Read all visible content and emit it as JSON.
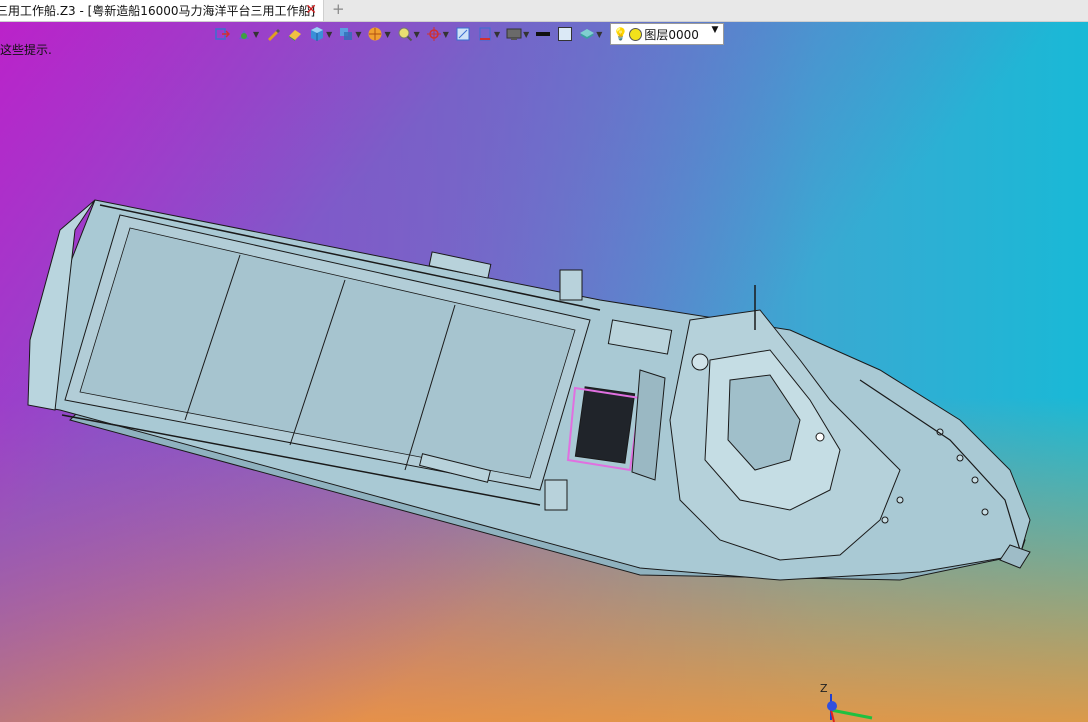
{
  "tab": {
    "title": "三用工作船.Z3 - [粤新造船16000马力海洋平台三用工作船]",
    "close_glyph": "✕",
    "add_glyph": "+"
  },
  "hint_text": "这些提示.",
  "toolbar": {
    "tools": [
      {
        "icon": "exit-sketch-icon",
        "dropdown": false
      },
      {
        "icon": "sketch-tools-icon",
        "dropdown": true
      },
      {
        "icon": "pen-icon",
        "dropdown": false
      },
      {
        "icon": "eraser-icon",
        "dropdown": false
      },
      {
        "icon": "cube-icon",
        "dropdown": true
      },
      {
        "icon": "views-icon",
        "dropdown": true
      },
      {
        "icon": "render-sphere-icon",
        "dropdown": true
      },
      {
        "icon": "zoom-icon",
        "dropdown": true
      },
      {
        "icon": "pivot-icon",
        "dropdown": true
      },
      {
        "icon": "fit-view-icon",
        "dropdown": false
      },
      {
        "icon": "section-icon",
        "dropdown": true
      },
      {
        "icon": "monitor-icon",
        "dropdown": true
      },
      {
        "icon": "line-weight-icon",
        "dropdown": false
      },
      {
        "icon": "color-swatch-icon",
        "dropdown": false
      },
      {
        "icon": "layers-icon",
        "dropdown": true
      }
    ],
    "layer": {
      "name": "图层0000",
      "color": "#f2e21a"
    }
  },
  "colors": {
    "hull": "#a9c9d4",
    "edge": "#1a1a1a",
    "highlight": "#e070e0"
  },
  "triad": {
    "z_label": "Z"
  }
}
